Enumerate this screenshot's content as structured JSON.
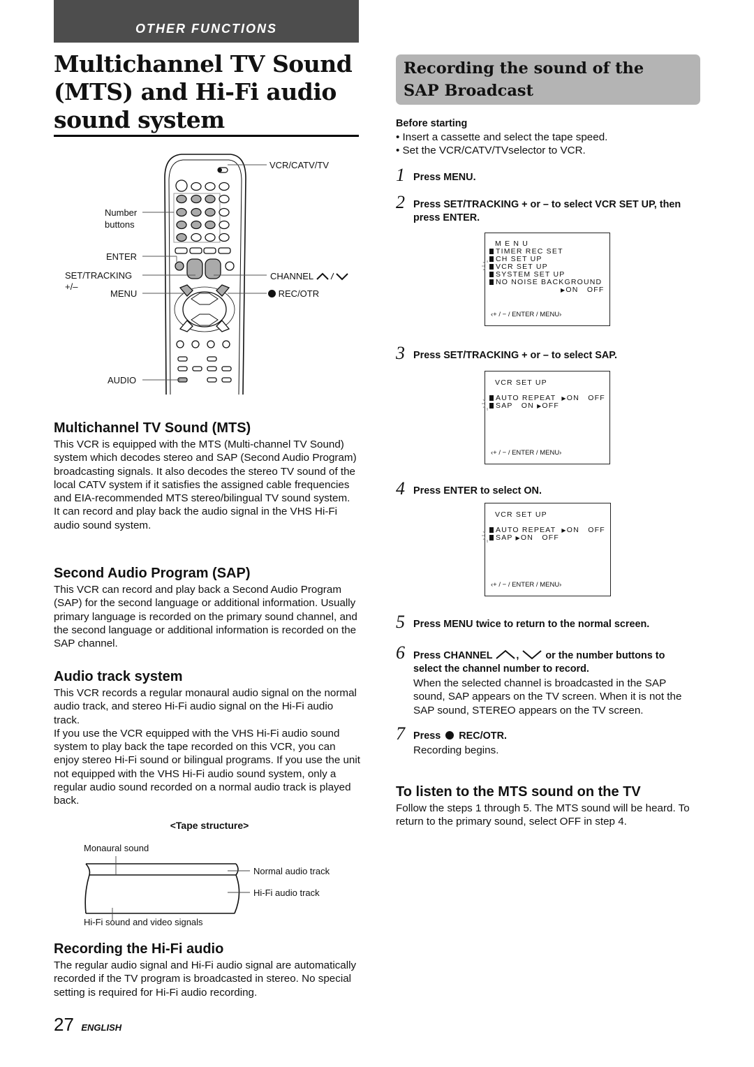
{
  "header": {
    "section_label": "OTHER FUNCTIONS",
    "page_title": "Multichannel TV Sound (MTS) and Hi-Fi audio sound system"
  },
  "remote_diagram": {
    "labels": {
      "vcr_catv_tv": "VCR/CATV/TV",
      "number_buttons_1": "Number",
      "number_buttons_2": "buttons",
      "enter": "ENTER",
      "set_tracking": "SET/TRACKING",
      "plus_minus": "+/–",
      "channel": "CHANNEL",
      "menu": "MENU",
      "rec_otr": "REC/OTR",
      "audio": "AUDIO"
    }
  },
  "left_sections": [
    {
      "heading": "Multichannel TV Sound (MTS)",
      "paragraphs": [
        "This VCR is equipped with the MTS (Multi-channel TV Sound) system which decodes stereo and SAP (Second Audio Program) broadcasting signals. It also decodes the stereo TV sound of the local CATV system if it satisfies the assigned cable frequencies and EIA-recommended MTS stereo/bilingual TV sound system.",
        "It can record and play back the audio signal in the VHS Hi-Fi audio sound system."
      ]
    },
    {
      "heading": "Second Audio Program (SAP)",
      "paragraphs": [
        "This VCR can record and play back a Second Audio Program (SAP) for the second language or additional information. Usually primary language is recorded on the primary sound channel, and the second language or additional information is recorded on the SAP channel."
      ]
    },
    {
      "heading": "Audio track system",
      "paragraphs": [
        "This VCR records a regular monaural audio signal on the normal audio track, and stereo Hi-Fi audio signal on the Hi-Fi audio track.",
        "If you use the VCR equipped with the VHS Hi-Fi audio sound system to play back the tape recorded on this VCR, you can enjoy stereo Hi-Fi sound or bilingual programs. If you use the unit not equipped with the VHS Hi-Fi audio sound system, only a regular audio sound recorded on a normal audio track is played back."
      ]
    },
    {
      "heading": "Recording the Hi-Fi audio",
      "paragraphs": [
        "The regular audio signal and Hi-Fi audio signal are automatically recorded if the TV program is broadcasted in stereo. No special setting is required for Hi-Fi audio recording."
      ]
    }
  ],
  "tape_diagram": {
    "title": "<Tape structure>",
    "monaural_sound": "Monaural sound",
    "normal_audio_track": "Normal audio track",
    "hifi_audio_track": "Hi-Fi audio track",
    "hifi_sound_video": "Hi-Fi sound and video signals"
  },
  "right": {
    "heading": "Recording the sound of the SAP Broadcast",
    "before_starting": {
      "title": "Before starting",
      "bullets": [
        "Insert a cassette and select the tape speed.",
        "Set the VCR/CATV/TVselector to VCR."
      ]
    },
    "steps": [
      {
        "num": "1",
        "text": "Press MENU."
      },
      {
        "num": "2",
        "text": "Press SET/TRACKING + or – to select VCR SET UP, then press ENTER."
      },
      {
        "num": "3",
        "text": "Press SET/TRACKING + or – to select SAP."
      },
      {
        "num": "4",
        "text": "Press ENTER to select ON."
      },
      {
        "num": "5",
        "text": "Press MENU twice to return to the normal screen."
      },
      {
        "num": "6",
        "text_a": "Press CHANNEL",
        "text_b": "or the number buttons to",
        "text_c": "select the channel number to record.",
        "note": "When the selected channel is broadcasted in the SAP sound, SAP appears on the TV screen. When it is not the SAP sound, STEREO appears on the TV screen."
      },
      {
        "num": "7",
        "text_a": "Press",
        "text_b": "REC/OTR.",
        "note": "Recording begins."
      }
    ],
    "screens": {
      "menu": {
        "title": "M E N U",
        "items": [
          "TIMER REC SET",
          "CH SET UP",
          "VCR SET UP",
          "SYSTEM SET UP",
          "NO NOISE BACKGROUND"
        ],
        "option_on": "ON",
        "option_off": "OFF",
        "nav": "‹+ / − / ENTER / MENU›"
      },
      "vcr_setup_1": {
        "title": "VCR SET UP",
        "auto_repeat": "AUTO REPEAT",
        "sap": "SAP",
        "on": "ON",
        "off": "OFF",
        "auto_repeat_selected": "ON",
        "sap_selected": "OFF",
        "nav": "‹+ / − / ENTER / MENU›"
      },
      "vcr_setup_2": {
        "title": "VCR SET UP",
        "auto_repeat": "AUTO REPEAT",
        "sap": "SAP",
        "on": "ON",
        "off": "OFF",
        "auto_repeat_selected": "ON",
        "sap_selected": "ON",
        "nav": "‹+ / − / ENTER / MENU›"
      }
    },
    "listen": {
      "heading": "To listen to the MTS sound on the TV",
      "text": "Follow the steps 1 through 5. The MTS sound will be heard. To return to the primary sound, select OFF in step 4."
    }
  },
  "footer": {
    "page_number": "27",
    "language": "ENGLISH"
  }
}
